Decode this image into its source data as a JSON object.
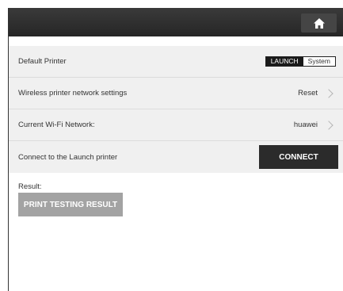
{
  "header": {
    "home_icon": "home-icon"
  },
  "settings": {
    "default_printer": {
      "label": "Default Printer",
      "options": [
        "LAUNCH",
        "System"
      ],
      "selected": "LAUNCH"
    },
    "wireless_settings": {
      "label": "Wireless printer network settings",
      "value": "Reset"
    },
    "wifi_network": {
      "label": "Current Wi-Fi Network:",
      "value": "huawei"
    },
    "connect": {
      "label": "Connect to the Launch printer",
      "button": "CONNECT"
    }
  },
  "result": {
    "label": "Result:",
    "button": "PRINT TESTING RESULT"
  }
}
